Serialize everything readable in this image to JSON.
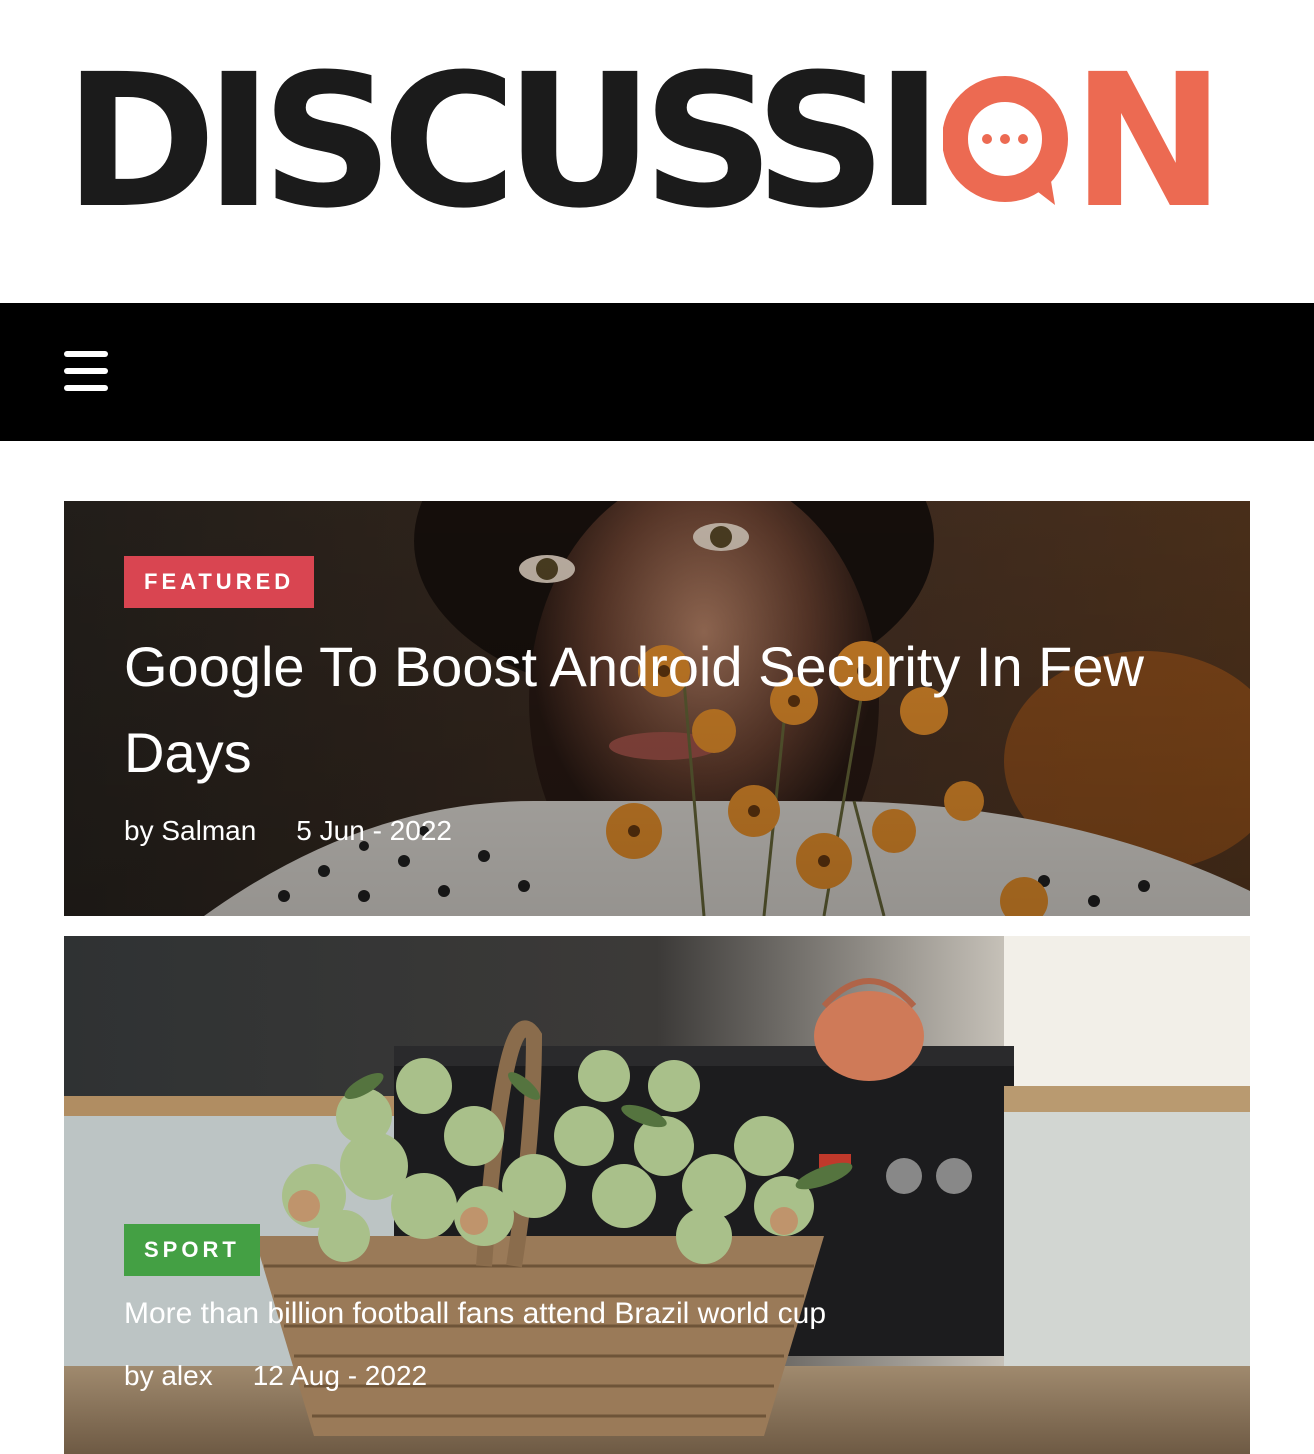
{
  "brand": {
    "logo_text_dark": "DISCUSSI",
    "logo_text_accent": "N",
    "accent_color": "#ec6a52",
    "dark_color": "#1b1b1b"
  },
  "nav": {
    "menu_icon": "hamburger-menu-icon",
    "background": "#000000"
  },
  "posts": [
    {
      "category": "FEATURED",
      "category_color": "#d94551",
      "title": "Google To Boost Android Security In Few Days",
      "author": "by Salman",
      "date": "5 Jun - 2022",
      "image": "woman-with-orange-flowers"
    },
    {
      "category": "SPORT",
      "category_color": "#44a044",
      "title": "More than billion football fans attend Brazil world cup",
      "author": "by alex",
      "date": "12 Aug - 2022",
      "image": "basket-of-apples-in-kitchen"
    }
  ]
}
